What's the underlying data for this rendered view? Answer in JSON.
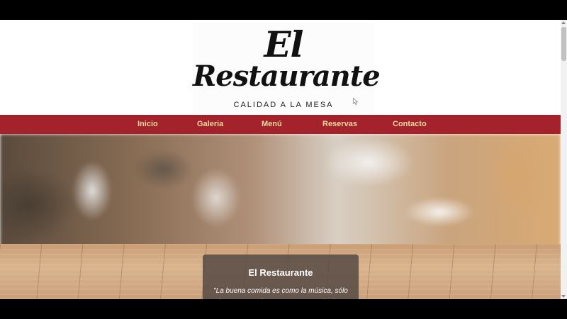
{
  "logo": {
    "line1": "El",
    "line2": "Restaurante",
    "tagline": "CALIDAD A LA MESA"
  },
  "nav": {
    "items": [
      {
        "label": "Inicio"
      },
      {
        "label": "Galeria"
      },
      {
        "label": "Menú"
      },
      {
        "label": "Reservas"
      },
      {
        "label": "Contacto"
      }
    ]
  },
  "hero": {
    "title": "El Restaurante",
    "quote": "\"La buena comida es como la música, sólo hay que quedarse atento y apreciar los sabores.\""
  },
  "colors": {
    "nav_bg": "#a3222b",
    "nav_text": "#f2d9a0",
    "card_bg": "#50463f"
  },
  "icons": {
    "cursor": "mouse-pointer-icon"
  }
}
